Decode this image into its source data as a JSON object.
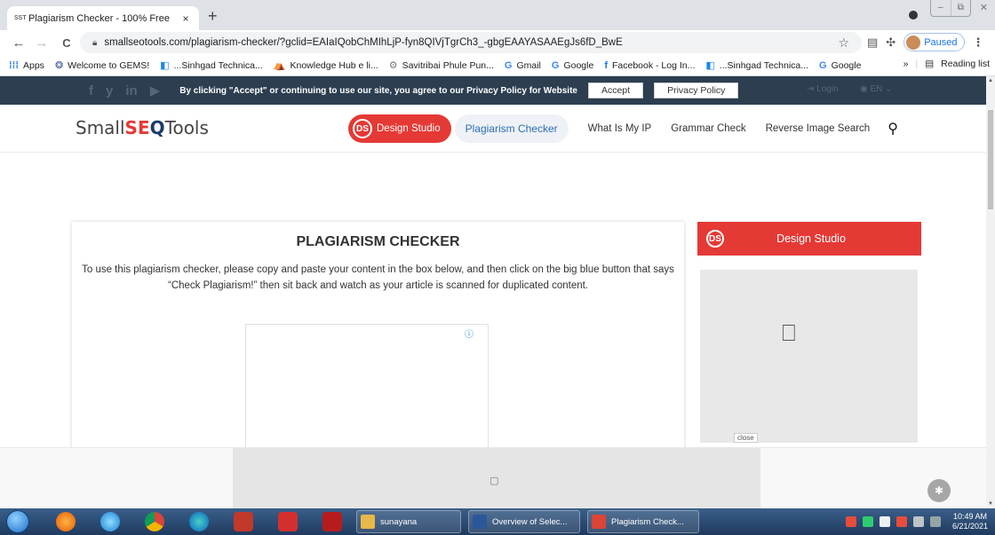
{
  "browser": {
    "tab": {
      "favicon_text": "SST",
      "title": "Plagiarism Checker - 100% Free",
      "close": "×"
    },
    "new_tab": "+",
    "window_controls": {
      "minimize": "–",
      "maximize": "⧉",
      "close": "✕"
    },
    "nav": {
      "back": "←",
      "forward": "→",
      "reload": "C"
    },
    "url": "smallseotools.com/plagiarism-checker/?gclid=EAIaIQobChMIhLjP-fyn8QIVjTgrCh3_-gbgEAAYASAAEgJs6fD_BwE",
    "profile_status": "Paused",
    "bookmarks": [
      {
        "icon": "⁞⁞⁞",
        "label": "Apps",
        "color": "#1a73e8"
      },
      {
        "icon": "❂",
        "label": "Welcome to GEMS!",
        "color": "#3b5998"
      },
      {
        "icon": "◧",
        "label": "...Sinhgad Technica...",
        "color": "#1e88e5"
      },
      {
        "icon": "⛺",
        "label": "Knowledge Hub e li...",
        "color": "#f4b400"
      },
      {
        "icon": "⚙",
        "label": "Savitribai Phule Pun...",
        "color": "#777777"
      },
      {
        "icon": "G",
        "label": "Gmail",
        "color": "#4285f4"
      },
      {
        "icon": "G",
        "label": "Google",
        "color": "#4285f4"
      },
      {
        "icon": "f",
        "label": "Facebook - Log In...",
        "color": "#1877f2"
      },
      {
        "icon": "◧",
        "label": "...Sinhgad Technica...",
        "color": "#1e88e5"
      },
      {
        "icon": "G",
        "label": "Google",
        "color": "#4285f4"
      }
    ],
    "bookmarks_overflow": "»",
    "reading_list": "Reading list"
  },
  "consent": {
    "social": [
      "f",
      "y",
      "in",
      "▶"
    ],
    "message": "By clicking \"Accept\" or continuing to use our site, you agree to our Privacy Policy for Website",
    "accept": "Accept",
    "privacy": "Privacy Policy",
    "login": "⇥ Login",
    "lang": "◉ EN ⌄"
  },
  "site": {
    "logo": {
      "a": "Small",
      "b": "SE",
      "c": "Q",
      "d": "Tools"
    },
    "nav": {
      "design_studio": "Design Studio",
      "plagiarism": "Plagiarism Checker",
      "ip": "What Is My IP",
      "grammar": "Grammar Check",
      "reverse": "Reverse Image Search",
      "search_icon": "⚲"
    },
    "main": {
      "title": "PLAGIARISM CHECKER",
      "description": "To use this plagiarism checker, please copy and paste your content in the box below, and then click on the big blue button that says “Check Plagiarism!” then sit back and watch as your article is scanned for duplicated content.",
      "ad_info": "ⓘ"
    },
    "sidebar": {
      "design_studio": "Design Studio",
      "ad_close": "close"
    }
  },
  "taskbar": {
    "tasks": [
      {
        "label": "sunayana",
        "color": "#e8b84a",
        "width": 118
      },
      {
        "label": "Overview of Selec...",
        "color": "#2b579a",
        "width": 126
      },
      {
        "label": "Plagiarism Check...",
        "color": "#db4437",
        "width": 126
      }
    ],
    "clock": {
      "time": "10:49 AM",
      "date": "6/21/2021"
    }
  }
}
